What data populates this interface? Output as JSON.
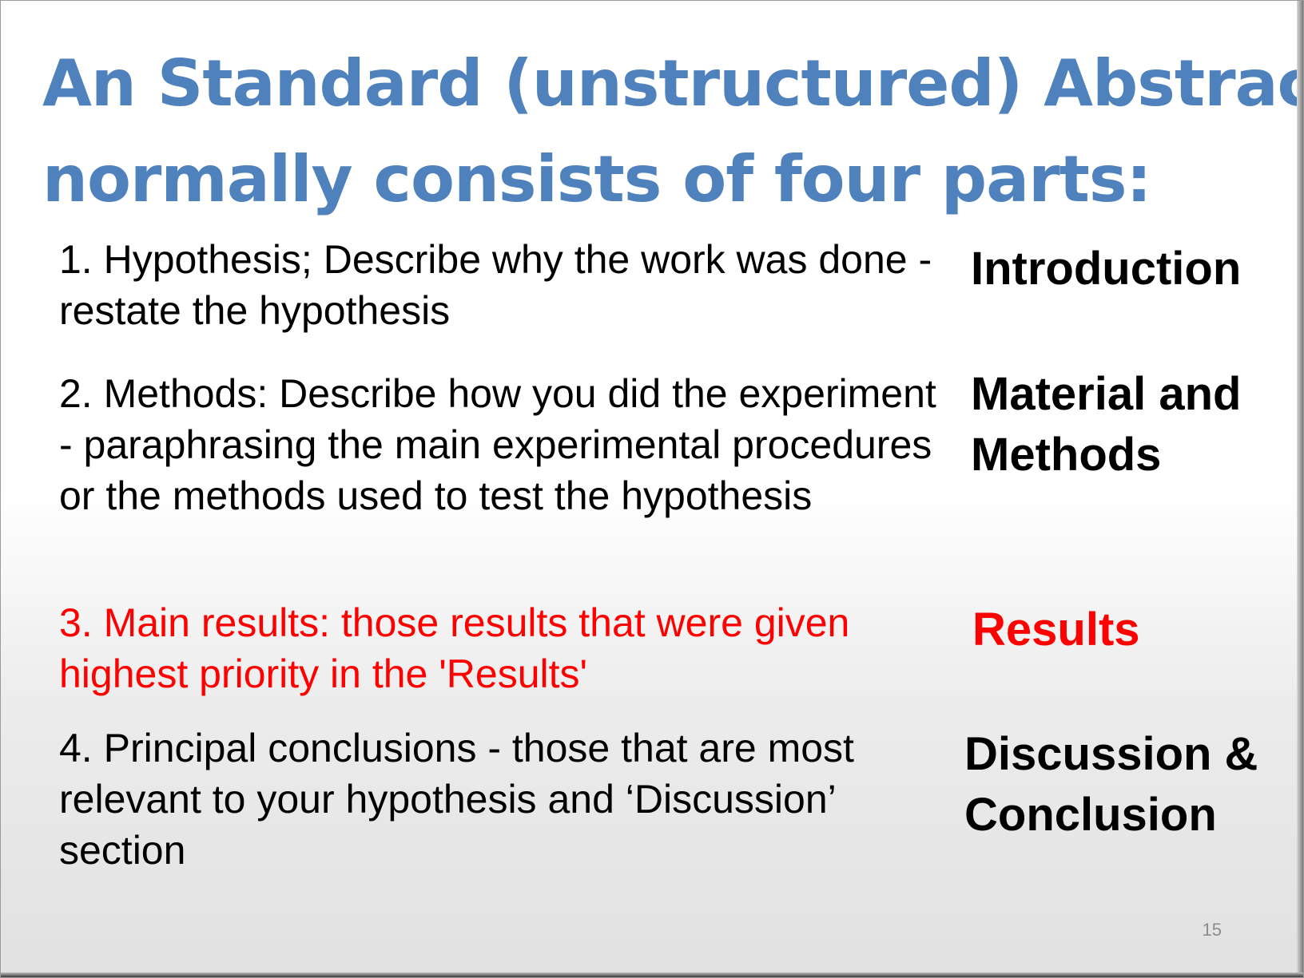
{
  "slide": {
    "title_line1": "An Standard (unstructured) Abstract",
    "title_line2": "normally consists of four parts:",
    "items": [
      {
        "text": "1. Hypothesis; Describe why the work was done - restate the hypothesis",
        "section": "Introduction",
        "section_line2": ""
      },
      {
        "text": "2. Methods: Describe how you did the experiment - paraphrasing the main experimental procedures or the methods used to test the hypothesis",
        "section": "Material and",
        "section_line2": "Methods"
      },
      {
        "text": "3. Main results: those results that were given highest priority in the 'Results'",
        "section": "Results",
        "section_line2": ""
      },
      {
        "text": "4. Principal conclusions - those that are most relevant to your hypothesis and ‘Discussion’ section",
        "section": "Discussion &",
        "section_line2": "Conclusion"
      }
    ],
    "page_number": "15",
    "colors": {
      "title": "#4f81bd",
      "highlight": "#ff0000",
      "text": "#000000"
    }
  }
}
